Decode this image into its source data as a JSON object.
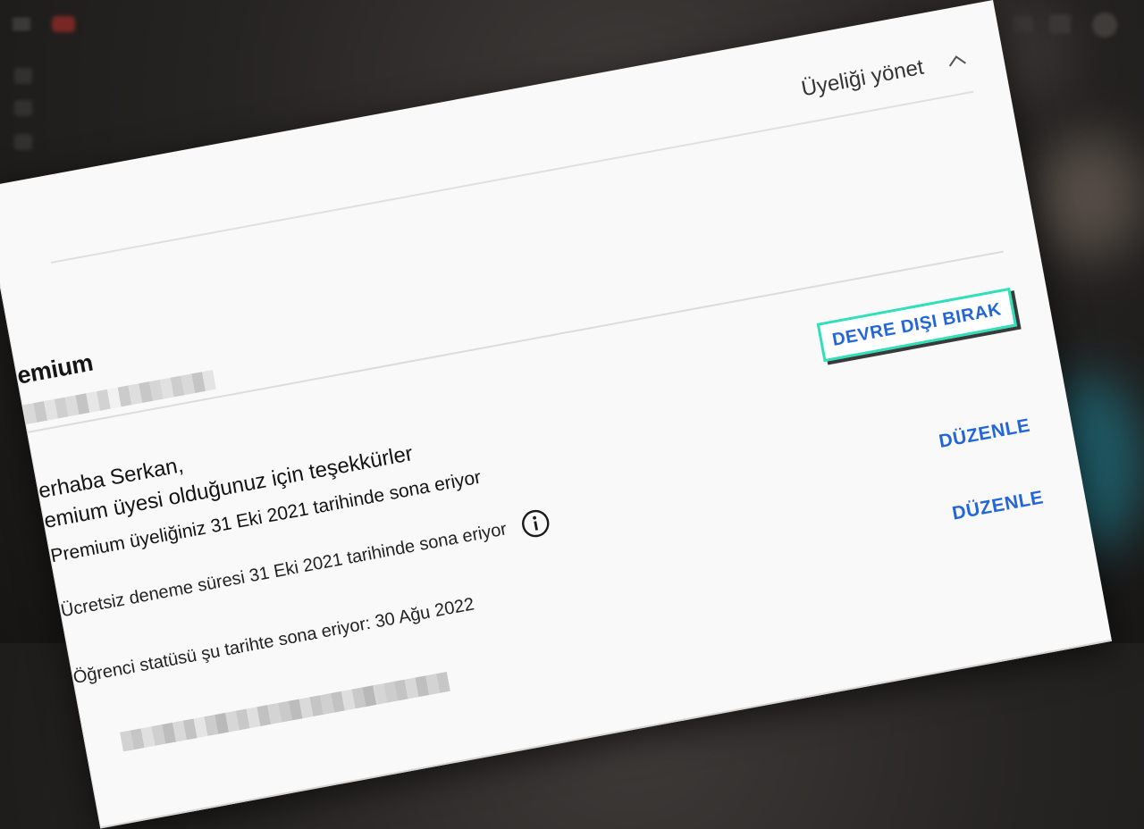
{
  "colors": {
    "accent_blue": "#2366d9",
    "focus_teal": "#2fe0b8",
    "card_bg": "#f9f9f9"
  },
  "background": {
    "icons": [
      "menu-icon",
      "logo-icon",
      "avatar-icon"
    ]
  },
  "header": {
    "manage_label": "Üyeliği yönet",
    "toggle_icon": "chevron-up-icon"
  },
  "plan": {
    "title": "emium"
  },
  "greeting": {
    "line1": "erhaba Serkan,",
    "line2": "emium üyesi olduğunuz için teşekkürler",
    "line3": "emium üyesi olduğunuz için teşekkürler"
  },
  "actions": {
    "deactivate_label": "DEVRE DIŞI BIRAK",
    "edit_label_1": "DÜZENLE",
    "edit_label_2": "DÜZENLE"
  },
  "status": {
    "expiry_line": "rhaba Serkan,",
    "trial_text": "Ücretsiz deneme süresi 31 Eki 2021 tarihinde sona eriyor",
    "trial_icon": "info-icon",
    "student_text": "Öğrenci statüsü şu tarihte sona eriyor: 30 Ağu 2022"
  }
}
